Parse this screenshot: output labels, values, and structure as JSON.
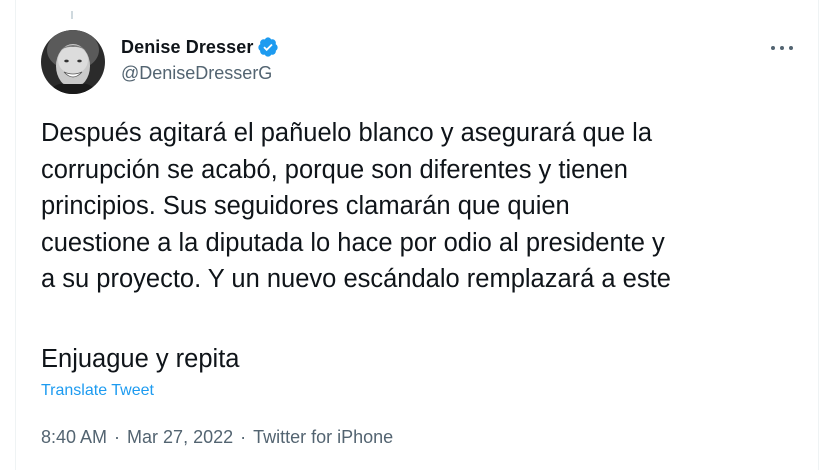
{
  "author": {
    "display_name": "Denise Dresser",
    "handle": "@DeniseDresserG",
    "verified": true,
    "verified_color": "#1d9bf0"
  },
  "tweet": {
    "lines": [
      "Después agitará el pañuelo blanco y asegurará que la",
      "corrupción se acabó, porque son diferentes y tienen",
      "principios. Sus seguidores clamarán que quien",
      "cuestione a la diputada lo hace por odio al presidente y",
      "a su proyecto. Y un nuevo escándalo remplazará a este"
    ],
    "second_paragraph": "Enjuague y repita",
    "translate_label": "Translate Tweet"
  },
  "meta": {
    "time": "8:40 AM",
    "separator": "·",
    "date": "Mar 27, 2022",
    "source": "Twitter for iPhone"
  },
  "icons": {
    "more": "more-horizontal-icon",
    "verified": "verified-badge-icon"
  }
}
